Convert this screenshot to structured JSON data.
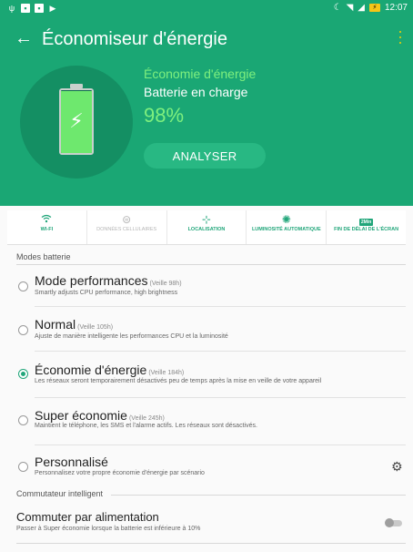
{
  "status_bar": {
    "left_icons": [
      "notification-icon",
      "gallery-icon",
      "photo-icon",
      "play-icon"
    ],
    "time": "12:07"
  },
  "header": {
    "title": "Économiseur d'énergie",
    "current_mode": "Économie d'énergie",
    "charging_status": "Batterie en charge",
    "battery_percent": "98%",
    "battery_level": 0.98,
    "analyse_label": "ANALYSER"
  },
  "quick_toggles": [
    {
      "label": "WI-FI",
      "icon": "wifi-icon",
      "active": true
    },
    {
      "label": "DONNÉES CELLULAIRES",
      "icon": "cellular-data-icon",
      "active": false
    },
    {
      "label": "LOCALISATION",
      "icon": "location-icon",
      "active": true
    },
    {
      "label": "LUMINOSITÉ AUTOMATIQUE",
      "icon": "brightness-icon",
      "active": true
    },
    {
      "label": "FIN DE DÉLAI DE L'ÉCRAN",
      "icon": "screen-timeout-icon",
      "active": true,
      "badge": "2Min"
    }
  ],
  "battery_modes": {
    "header": "Modes batterie",
    "items": [
      {
        "title": "Mode performances",
        "veille": "(Veille 98h)",
        "desc": "Smartly adjusts CPU performance, high brightness",
        "selected": false
      },
      {
        "title": "Normal",
        "veille": "(Veille 105h)",
        "desc": "Ajuste de manière intelligente les performances CPU et la luminosité",
        "selected": false
      },
      {
        "title": "Économie d'énergie",
        "veille": "(Veille 184h)",
        "desc": "Les réseaux seront temporairement désactivés peu de temps après la mise en veille de votre appareil",
        "selected": true
      },
      {
        "title": "Super économie",
        "veille": "(Veille 245h)",
        "desc": "Maintient le téléphone, les SMS et l'alarme actifs. Les réseaux sont désactivés.",
        "selected": false
      },
      {
        "title": "Personnalisé",
        "veille": "",
        "desc": "Personnalisez votre propre économie d'énergie par scénario",
        "selected": false
      }
    ]
  },
  "smart_switch": {
    "header": "Commutateur intelligent",
    "title": "Commuter par alimentation",
    "desc": "Passer à Super économie lorsque la batterie est inférieure à 10%",
    "enabled": false
  },
  "colors": {
    "header_green": "#1aa774",
    "accent_green": "#21a67a",
    "highlight_green": "#7ef07e"
  }
}
